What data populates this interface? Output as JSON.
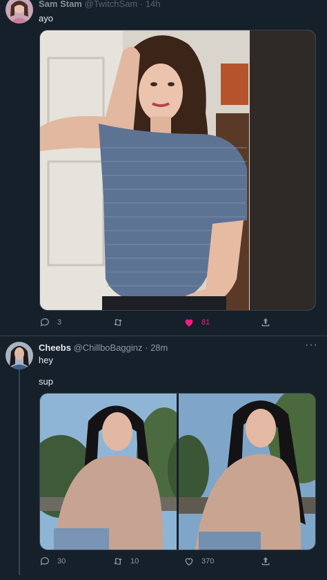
{
  "tweet1": {
    "display_name": "Sam Stam",
    "handle": "@TwitchSam · 14h",
    "text": "ayo",
    "reply_count": "3",
    "retweet_count": "",
    "like_count": "81",
    "liked": true
  },
  "tweet2": {
    "display_name": "Cheebs",
    "handle": "@ChillboBagginz",
    "time": "· 28m",
    "text1": "hey",
    "text2": "sup",
    "reply_count": "30",
    "retweet_count": "10",
    "like_count": "370"
  },
  "colors": {
    "background": "#15202b",
    "border": "#38444d",
    "muted": "#8b98a5",
    "like_active": "#f91880"
  },
  "icons": [
    "reply-icon",
    "retweet-icon",
    "like-icon",
    "share-icon",
    "more-icon"
  ]
}
